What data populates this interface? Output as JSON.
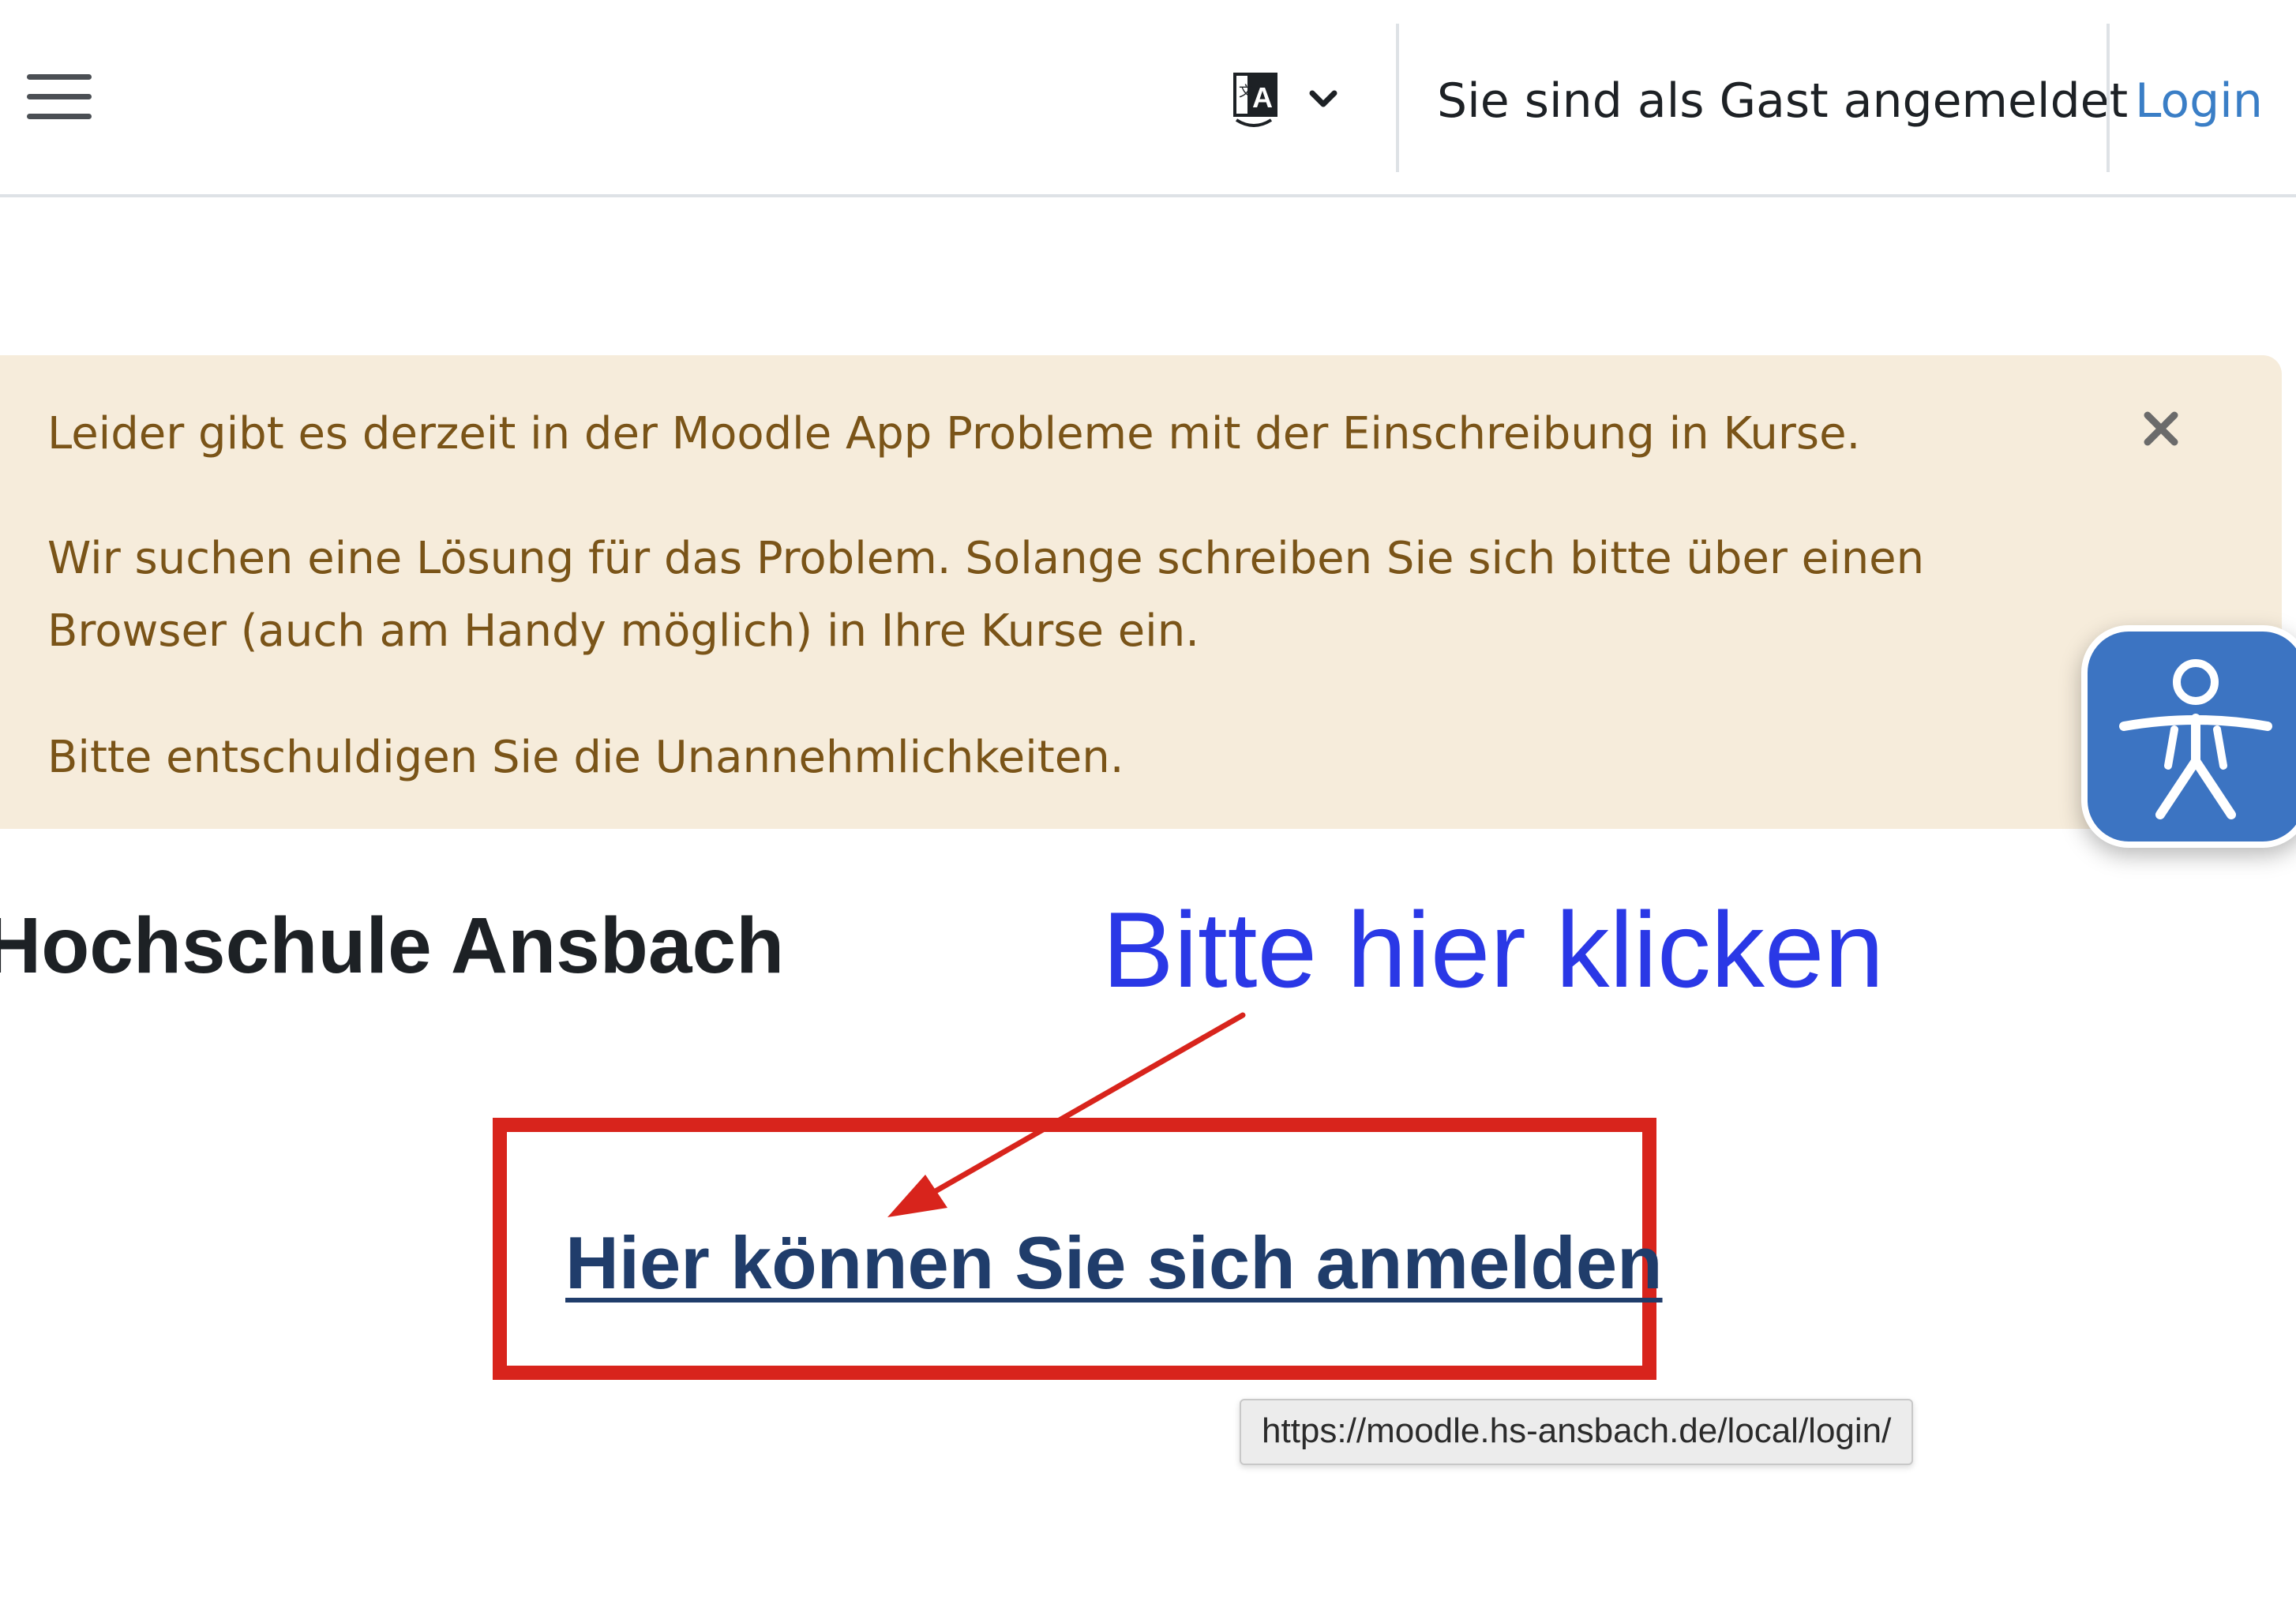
{
  "navbar": {
    "menu_icon": "hamburger-menu-icon",
    "language_icon": "translate-icon",
    "language_chevron_icon": "chevron-down-icon",
    "guest_text": "Sie sind als Gast angemeldet",
    "login_label": "Login"
  },
  "alert": {
    "close_icon": "close-icon",
    "line1": "Leider gibt es derzeit in der Moodle App Probleme mit der Einschreibung in Kurse.",
    "line2": "Wir suchen eine Lösung für das Problem. Solange schreiben Sie sich bitte über einen Browser (auch am Handy möglich) in Ihre Kurse ein.",
    "line3": "Bitte entschuldigen Sie die Unannehmlichkeiten."
  },
  "accessibility": {
    "icon": "accessibility-person-icon"
  },
  "main": {
    "site_title": "Hochschule Ansbach",
    "signup_link": "Hier können Sie sich anmelden",
    "link_url_tooltip": "https://moodle.hs-ansbach.de/local/login/"
  },
  "annotation": {
    "text": "Bitte hier klicken",
    "text_color": "#2a38e6",
    "arrow_color": "#d8241c",
    "box_color": "#d8241c"
  },
  "colors": {
    "alert_background": "#f6ecdb",
    "alert_text": "#7a5418",
    "link": "#3a7ec6",
    "accessibility_button": "#3c74c2"
  }
}
